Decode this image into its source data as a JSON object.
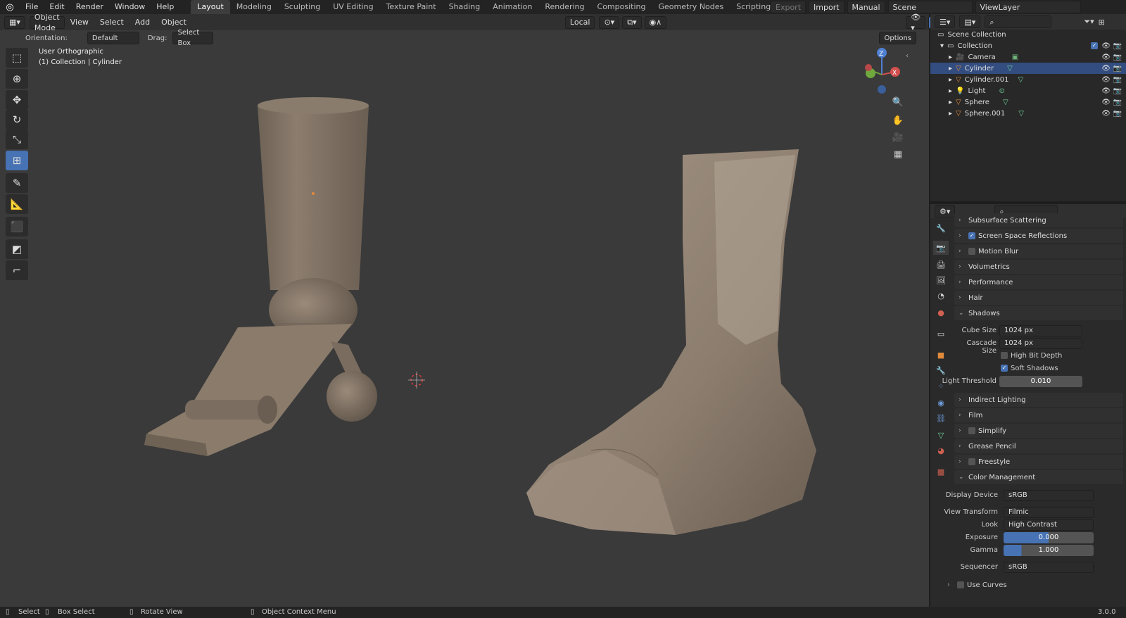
{
  "menu": [
    "File",
    "Edit",
    "Render",
    "Window",
    "Help"
  ],
  "workspaces": [
    "Layout",
    "Modeling",
    "Sculpting",
    "UV Editing",
    "Texture Paint",
    "Shading",
    "Animation",
    "Rendering",
    "Compositing",
    "Geometry Nodes",
    "Scripting"
  ],
  "topright": {
    "export": "Export",
    "import": "Import",
    "manual": "Manual",
    "scene": "Scene",
    "viewlayer": "ViewLayer"
  },
  "viewport": {
    "mode": "Object Mode",
    "menus": [
      "View",
      "Select",
      "Add",
      "Object"
    ],
    "transform": "Local",
    "orientation_label": "Orientation:",
    "orientation": "Default",
    "drag_label": "Drag:",
    "drag": "Select Box",
    "options": "Options",
    "info1": "User Orthographic",
    "info2": "(1) Collection | Cylinder"
  },
  "outliner": {
    "scene_collection": "Scene Collection",
    "collection": "Collection",
    "items": [
      "Camera",
      "Cylinder",
      "Cylinder.001",
      "Light",
      "Sphere",
      "Sphere.001"
    ]
  },
  "props": {
    "panels": {
      "sss": "Subsurface Scattering",
      "ssr": "Screen Space Reflections",
      "mb": "Motion Blur",
      "vol": "Volumetrics",
      "perf": "Performance",
      "hair": "Hair",
      "shadows": "Shadows",
      "indirect": "Indirect Lighting",
      "film": "Film",
      "simplify": "Simplify",
      "gp": "Grease Pencil",
      "freestyle": "Freestyle",
      "cm": "Color Management"
    },
    "shadows": {
      "cube_label": "Cube Size",
      "cube": "1024 px",
      "cascade_label": "Cascade Size",
      "cascade": "1024 px",
      "hbd": "High Bit Depth",
      "soft": "Soft Shadows",
      "thr_label": "Light Threshold",
      "thr": "0.010"
    },
    "cm": {
      "dd_label": "Display Device",
      "dd": "sRGB",
      "vt_label": "View Transform",
      "vt": "Filmic",
      "look_label": "Look",
      "look": "High Contrast",
      "exp_label": "Exposure",
      "exp": "0.000",
      "gamma_label": "Gamma",
      "gamma": "1.000",
      "seq_label": "Sequencer",
      "seq": "sRGB",
      "curves": "Use Curves"
    }
  },
  "status": {
    "select": "Select",
    "box": "Box Select",
    "rotate": "Rotate View",
    "ctx": "Object Context Menu",
    "version": "3.0.0"
  },
  "colors": {
    "accent": "#4772b3",
    "orange": "#e08a3c",
    "mesh": "#8c7d6e"
  }
}
